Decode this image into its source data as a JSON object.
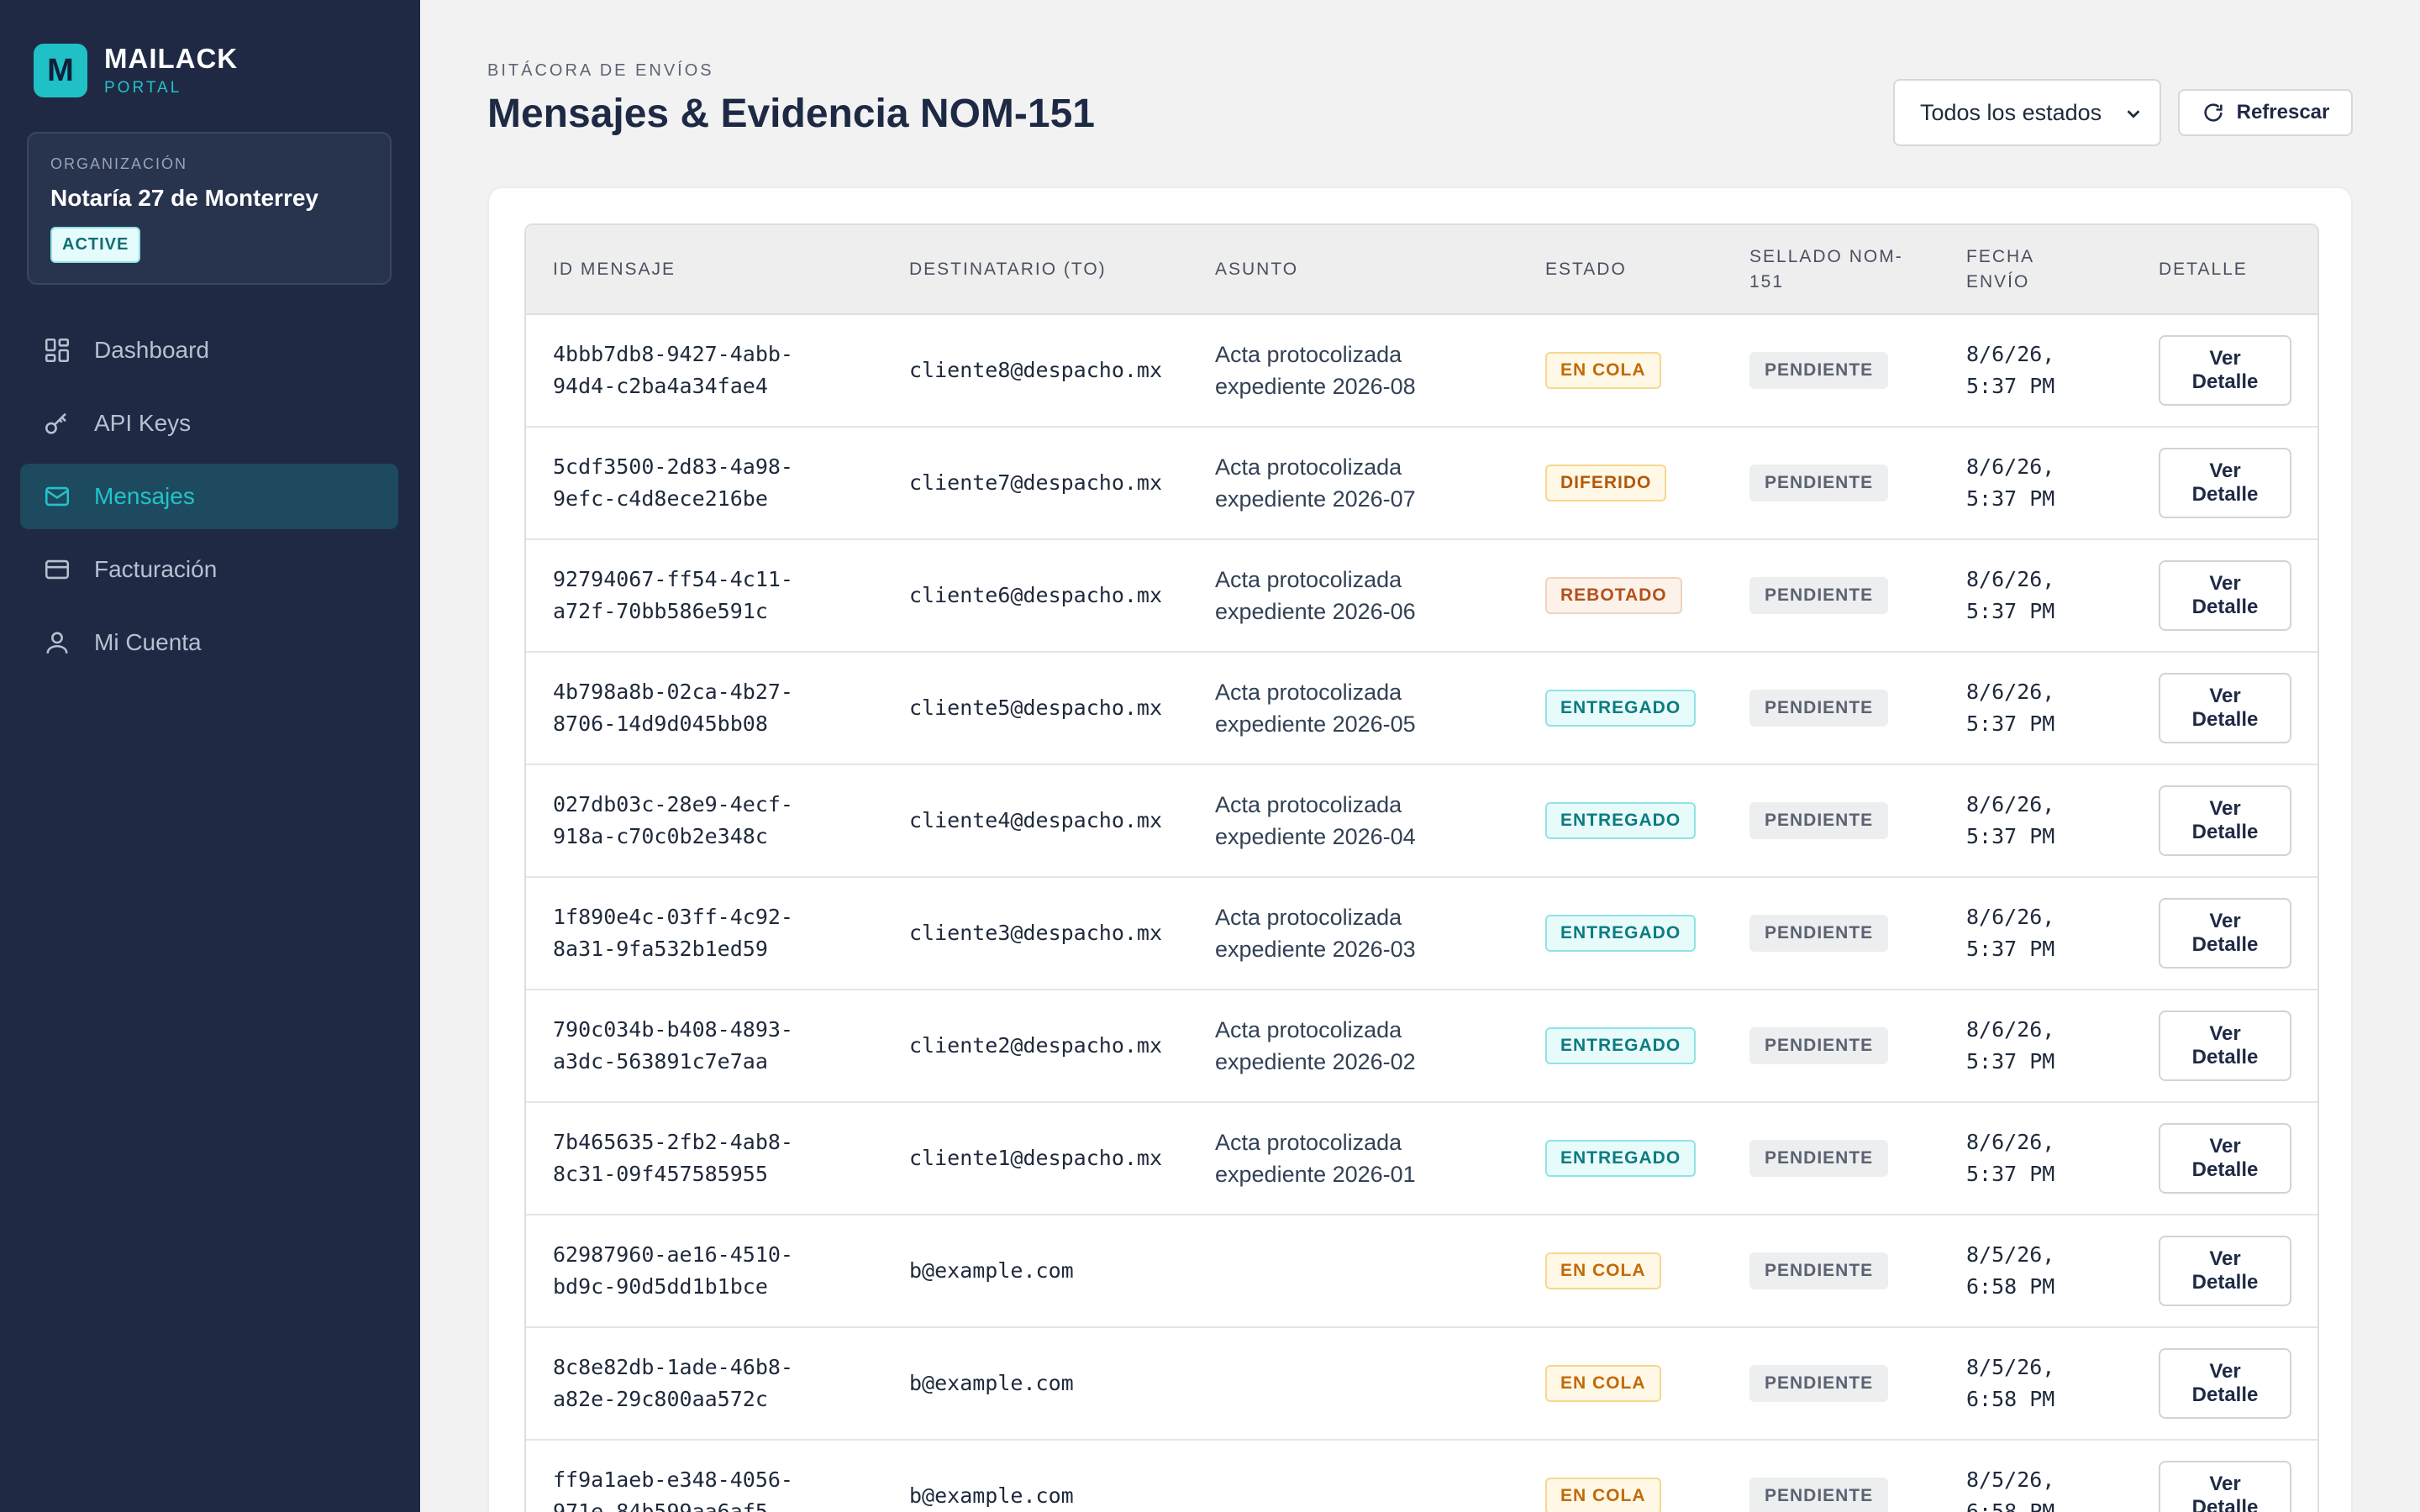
{
  "brand": {
    "logo_letter": "M",
    "name": "MAILACK",
    "sub": "PORTAL",
    "accent": "#1fc1c6"
  },
  "org": {
    "label": "ORGANIZACIÓN",
    "name": "Notaría 27 de Monterrey",
    "badge": "ACTIVE"
  },
  "nav": [
    {
      "label": "Dashboard",
      "icon": "dashboard-icon",
      "active": false
    },
    {
      "label": "API Keys",
      "icon": "key-icon",
      "active": false
    },
    {
      "label": "Mensajes",
      "icon": "mail-icon",
      "active": true
    },
    {
      "label": "Facturación",
      "icon": "credit-card-icon",
      "active": false
    },
    {
      "label": "Mi Cuenta",
      "icon": "user-icon",
      "active": false
    }
  ],
  "header": {
    "kicker": "BITÁCORA DE ENVÍOS",
    "title": "Mensajes & Evidencia NOM-151",
    "status_filter": "Todos los estados",
    "refresh_label": "Refrescar"
  },
  "table": {
    "columns": [
      "ID MENSAJE",
      "DESTINATARIO (TO)",
      "ASUNTO",
      "ESTADO",
      "SELLADO NOM-151",
      "FECHA ENVÍO",
      "DETALLE"
    ],
    "detail_label": "Ver Detalle",
    "rows": [
      {
        "id": "4bbb7db8-9427-4abb-94d4-c2ba4a34fae4",
        "to": "cliente8@despacho.mx",
        "subject": "Acta protocolizada expediente 2026-08",
        "status": "EN COLA",
        "kind": "cola",
        "seal": "PENDIENTE",
        "date": "8/6/26, 5:37 PM"
      },
      {
        "id": "5cdf3500-2d83-4a98-9efc-c4d8ece216be",
        "to": "cliente7@despacho.mx",
        "subject": "Acta protocolizada expediente 2026-07",
        "status": "DIFERIDO",
        "kind": "diferido",
        "seal": "PENDIENTE",
        "date": "8/6/26, 5:37 PM"
      },
      {
        "id": "92794067-ff54-4c11-a72f-70bb586e591c",
        "to": "cliente6@despacho.mx",
        "subject": "Acta protocolizada expediente 2026-06",
        "status": "REBOTADO",
        "kind": "rebotado",
        "seal": "PENDIENTE",
        "date": "8/6/26, 5:37 PM"
      },
      {
        "id": "4b798a8b-02ca-4b27-8706-14d9d045bb08",
        "to": "cliente5@despacho.mx",
        "subject": "Acta protocolizada expediente 2026-05",
        "status": "ENTREGADO",
        "kind": "entregado",
        "seal": "PENDIENTE",
        "date": "8/6/26, 5:37 PM"
      },
      {
        "id": "027db03c-28e9-4ecf-918a-c70c0b2e348c",
        "to": "cliente4@despacho.mx",
        "subject": "Acta protocolizada expediente 2026-04",
        "status": "ENTREGADO",
        "kind": "entregado",
        "seal": "PENDIENTE",
        "date": "8/6/26, 5:37 PM"
      },
      {
        "id": "1f890e4c-03ff-4c92-8a31-9fa532b1ed59",
        "to": "cliente3@despacho.mx",
        "subject": "Acta protocolizada expediente 2026-03",
        "status": "ENTREGADO",
        "kind": "entregado",
        "seal": "PENDIENTE",
        "date": "8/6/26, 5:37 PM"
      },
      {
        "id": "790c034b-b408-4893-a3dc-563891c7e7aa",
        "to": "cliente2@despacho.mx",
        "subject": "Acta protocolizada expediente 2026-02",
        "status": "ENTREGADO",
        "kind": "entregado",
        "seal": "PENDIENTE",
        "date": "8/6/26, 5:37 PM"
      },
      {
        "id": "7b465635-2fb2-4ab8-8c31-09f457585955",
        "to": "cliente1@despacho.mx",
        "subject": "Acta protocolizada expediente 2026-01",
        "status": "ENTREGADO",
        "kind": "entregado",
        "seal": "PENDIENTE",
        "date": "8/6/26, 5:37 PM"
      },
      {
        "id": "62987960-ae16-4510-bd9c-90d5dd1b1bce",
        "to": "b@example.com",
        "subject": "",
        "status": "EN COLA",
        "kind": "cola",
        "seal": "PENDIENTE",
        "date": "8/5/26, 6:58 PM"
      },
      {
        "id": "8c8e82db-1ade-46b8-a82e-29c800aa572c",
        "to": "b@example.com",
        "subject": "",
        "status": "EN COLA",
        "kind": "cola",
        "seal": "PENDIENTE",
        "date": "8/5/26, 6:58 PM"
      },
      {
        "id": "ff9a1aeb-e348-4056-971e-84b599aa6af5",
        "to": "b@example.com",
        "subject": "",
        "status": "EN COLA",
        "kind": "cola",
        "seal": "PENDIENTE",
        "date": "8/5/26, 6:58 PM"
      }
    ]
  }
}
